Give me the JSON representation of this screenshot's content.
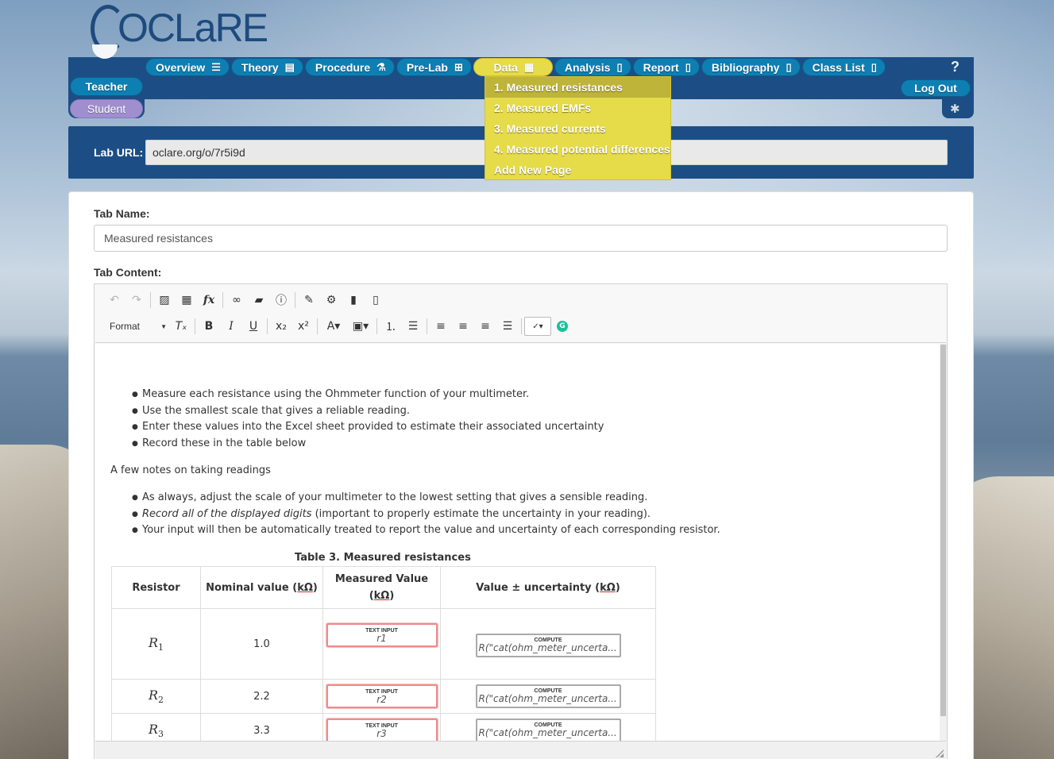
{
  "logo": {
    "text": "OCLaRE"
  },
  "nav": {
    "tabs": [
      {
        "label": "Overview",
        "icon": "list-icon",
        "glyph": "☰"
      },
      {
        "label": "Theory",
        "icon": "book-icon",
        "glyph": "▤"
      },
      {
        "label": "Procedure",
        "icon": "flask-icon",
        "glyph": "⚗"
      },
      {
        "label": "Pre-Lab",
        "icon": "sitemap-icon",
        "glyph": "⊞"
      },
      {
        "label": "Data",
        "icon": "calculator-icon",
        "glyph": "▦"
      },
      {
        "label": "Analysis",
        "icon": "file-icon",
        "glyph": "▯"
      },
      {
        "label": "Report",
        "icon": "clipboard-icon",
        "glyph": "▯"
      },
      {
        "label": "Bibliography",
        "icon": "clipboard-icon",
        "glyph": "▯"
      },
      {
        "label": "Class List",
        "icon": "clipboard-icon",
        "glyph": "▯"
      }
    ],
    "active": "Data",
    "help": "?",
    "logout": "Log Out",
    "bug_glyph": "✱"
  },
  "roles": {
    "teacher": "Teacher",
    "student": "Student"
  },
  "dropdown": {
    "items": [
      "1. Measured resistances",
      "2. Measured EMFs",
      "3. Measured currents",
      "4. Measured potential differences",
      "Add New Page"
    ],
    "active_index": 0
  },
  "lab_url": {
    "label": "Lab URL:",
    "value": "oclare.org/o/7r5i9d"
  },
  "tab_name": {
    "label": "Tab Name:",
    "value": "Measured resistances"
  },
  "tab_content": {
    "label": "Tab Content:"
  },
  "toolbar": {
    "format_label": "Format",
    "grammarly": "G"
  },
  "content": {
    "bullets1": [
      "Measure each resistance using the Ohmmeter function of your multimeter.",
      "Use the smallest scale that gives a reliable reading.",
      "Enter these values into the Excel sheet provided to estimate their associated uncertainty",
      "Record these in the table below"
    ],
    "para": "A few notes on taking readings",
    "bullets2": {
      "b1": "As always, adjust the scale of your multimeter to the lowest setting that gives a sensible reading.",
      "b2_italic": "Record all of the displayed digits",
      "b2_rest": " (important to properly estimate the uncertainty in your reading).",
      "b3": "Your input will then be automatically treated to report the value and uncertainty of each corresponding resistor."
    },
    "caption": "Table 3. Measured resistances",
    "table": {
      "headers": {
        "resistor": "Resistor",
        "nominal_pre": "Nominal value (",
        "nominal_unit": "kΩ",
        "nominal_post": ")",
        "measured_line1": "Measured Value",
        "measured_pre": "(",
        "measured_unit": "kΩ",
        "measured_post": ")",
        "vu_pre": "Value ± uncertainty (",
        "vu_unit": "kΩ",
        "vu_post": ")"
      },
      "rows": [
        {
          "var": "R",
          "sub": "1",
          "nominal": "1.0",
          "input_caption": "TEXT INPUT",
          "input": "r1",
          "compute_caption": "COMPUTE",
          "compute": "R(\"cat(ohm_meter_uncerta..."
        },
        {
          "var": "R",
          "sub": "2",
          "nominal": "2.2",
          "input_caption": "TEXT INPUT",
          "input": "r2",
          "compute_caption": "COMPUTE",
          "compute": "R(\"cat(ohm_meter_uncerta..."
        },
        {
          "var": "R",
          "sub": "3",
          "nominal": "3.3",
          "input_caption": "TEXT INPUT",
          "input": "r3",
          "compute_caption": "COMPUTE",
          "compute": "R(\"cat(ohm_meter_uncerta..."
        }
      ]
    }
  }
}
